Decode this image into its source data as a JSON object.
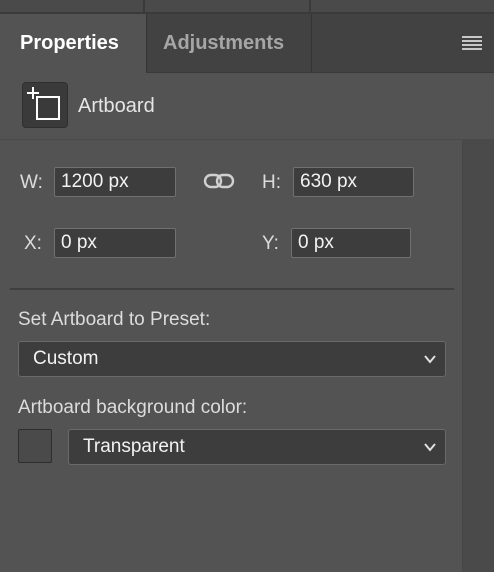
{
  "tabs": {
    "properties": "Properties",
    "adjustments": "Adjustments"
  },
  "header": {
    "panel_menu_icon": "hamburger-menu-icon",
    "artboard_icon": "artboard-icon",
    "artboard_label": "Artboard"
  },
  "dimensions": {
    "w_label": "W:",
    "w_value": "1200 px",
    "h_label": "H:",
    "h_value": "630 px",
    "x_label": "X:",
    "x_value": "0 px",
    "y_label": "Y:",
    "y_value": "0 px",
    "link_icon": "link-icon"
  },
  "preset": {
    "label": "Set Artboard to Preset:",
    "selected": "Custom"
  },
  "background": {
    "label": "Artboard background color:",
    "selected": "Transparent"
  },
  "colors": {
    "panel_bg": "#535353",
    "tabbar_bg": "#424242",
    "input_bg": "#3d3d3d",
    "text": "#e4e4e4",
    "inactive_tab_text": "#a6a6a6"
  }
}
